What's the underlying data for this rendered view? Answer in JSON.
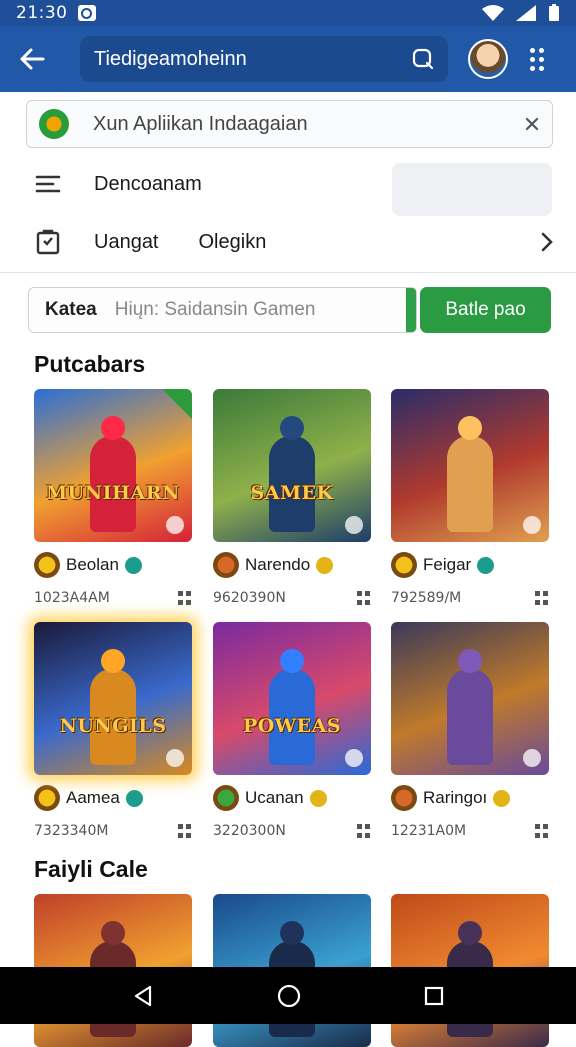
{
  "status_bar": {
    "time": "21:30"
  },
  "app_bar": {
    "search_text": "Tiedigeamoheinn"
  },
  "install_banner": {
    "text": "Xun Apliikan Indaagaian"
  },
  "menu": {
    "row1_label": "Dencoanam",
    "row2_label1": "Uangat",
    "row2_label2": "Olegikn"
  },
  "filter": {
    "label": "Katea",
    "placeholder": "Hiųn: Saidansin Gamen",
    "button": "Batle pao"
  },
  "sections": [
    {
      "title": "Putcabars",
      "cards": [
        {
          "title_art": "MUNIHARN",
          "name": "Beolan",
          "sub": "1023A4AM",
          "palette": [
            "#2b6fd6",
            "#f0a030",
            "#d4223a"
          ],
          "badge_color": "#1c9c8c",
          "icon_color": "#f3c21a"
        },
        {
          "title_art": "SAMEK",
          "name": "Narendo",
          "sub": "9620390N",
          "palette": [
            "#3b7a3a",
            "#8fb04a",
            "#1d3d6b"
          ],
          "badge_color": "#e2b416",
          "icon_color": "#d8682a"
        },
        {
          "title_art": "",
          "name": "Feigar",
          "sub": "792589/M",
          "palette": [
            "#2a2d6a",
            "#b03a2e",
            "#e0a050"
          ],
          "badge_color": "#1c9c8c",
          "icon_color": "#f3c21a"
        }
      ]
    },
    {
      "cards": [
        {
          "title_art": "NUNGILS",
          "name": "Aamea",
          "sub": "7323340M",
          "palette": [
            "#1a1a3a",
            "#3a6acc",
            "#d88a20"
          ],
          "badge_color": "#1c9c8c",
          "icon_color": "#f3c21a"
        },
        {
          "title_art": "POWEAS",
          "name": "Ucanan",
          "sub": "3220300N",
          "palette": [
            "#7a2aa0",
            "#d84a6a",
            "#2a6ad6"
          ],
          "badge_color": "#e2b416",
          "icon_color": "#3aa83a"
        },
        {
          "title_art": "",
          "name": "Raringoı",
          "sub": "12231A0M",
          "palette": [
            "#3a3a5a",
            "#c07a2a",
            "#6a4a9a"
          ],
          "badge_color": "#e2b416",
          "icon_color": "#d8682a"
        }
      ]
    },
    {
      "title": "Faiyli Cale",
      "cards": [
        {
          "palette": [
            "#c0402a",
            "#f0a030",
            "#6a2a2a"
          ]
        },
        {
          "palette": [
            "#1a4a8a",
            "#3aa0d0",
            "#1a2a4a"
          ]
        },
        {
          "palette": [
            "#c04a1a",
            "#f08a30",
            "#3a2a4a"
          ]
        }
      ]
    }
  ]
}
